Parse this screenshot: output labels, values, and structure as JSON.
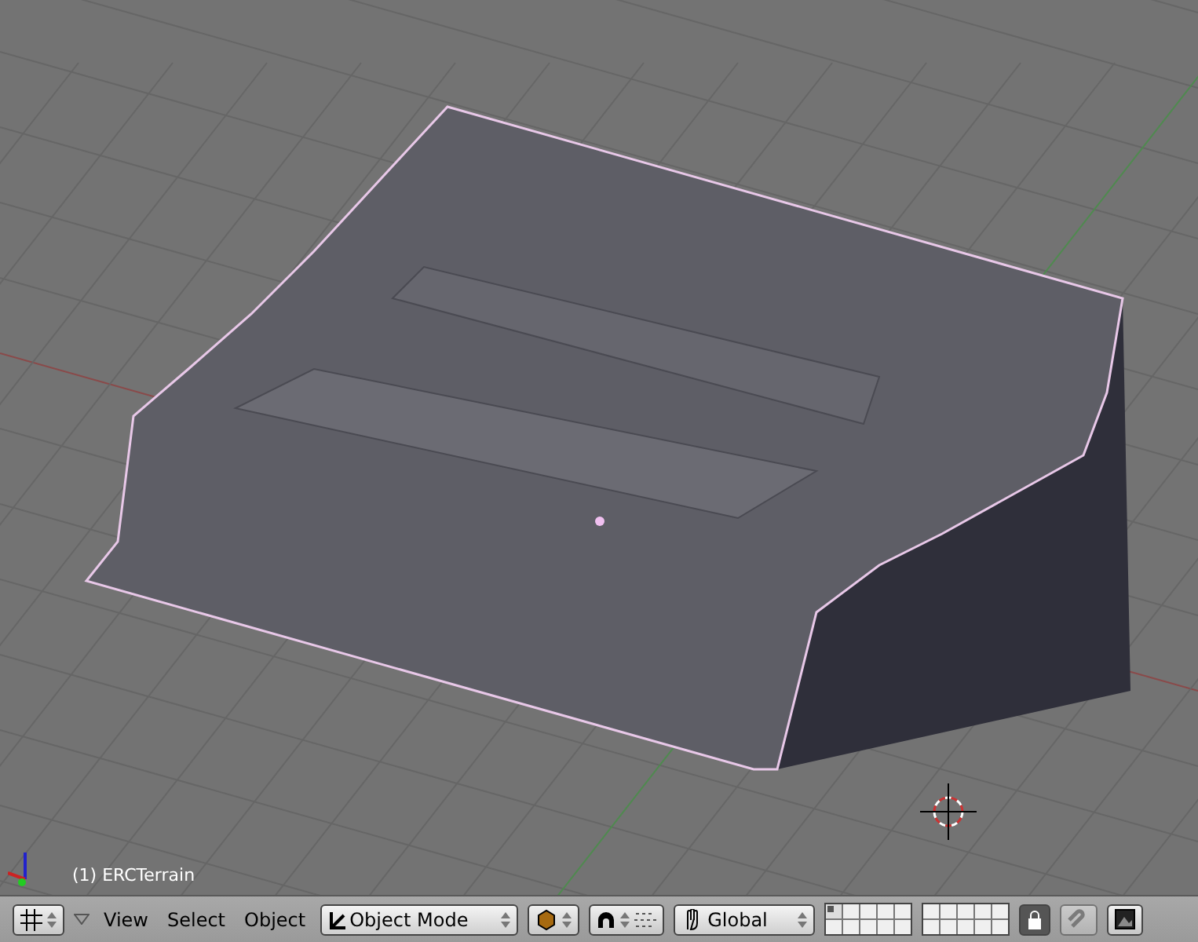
{
  "viewport": {
    "object_label": "(1) ERCTerrain"
  },
  "header": {
    "menus": [
      "View",
      "Select",
      "Object"
    ],
    "mode": "Object Mode",
    "orientation": "Global",
    "layers": [
      {
        "selected": true
      },
      {
        "selected": false
      },
      {
        "selected": false
      },
      {
        "selected": false
      },
      {
        "selected": false
      },
      {
        "selected": false
      },
      {
        "selected": false
      },
      {
        "selected": false
      },
      {
        "selected": false
      },
      {
        "selected": false
      },
      {
        "selected": false
      },
      {
        "selected": false
      },
      {
        "selected": false
      },
      {
        "selected": false
      },
      {
        "selected": false
      },
      {
        "selected": false
      },
      {
        "selected": false
      },
      {
        "selected": false
      },
      {
        "selected": false
      },
      {
        "selected": false
      }
    ],
    "lock_layers": {
      "on": true
    },
    "snap": {
      "on": false
    }
  }
}
